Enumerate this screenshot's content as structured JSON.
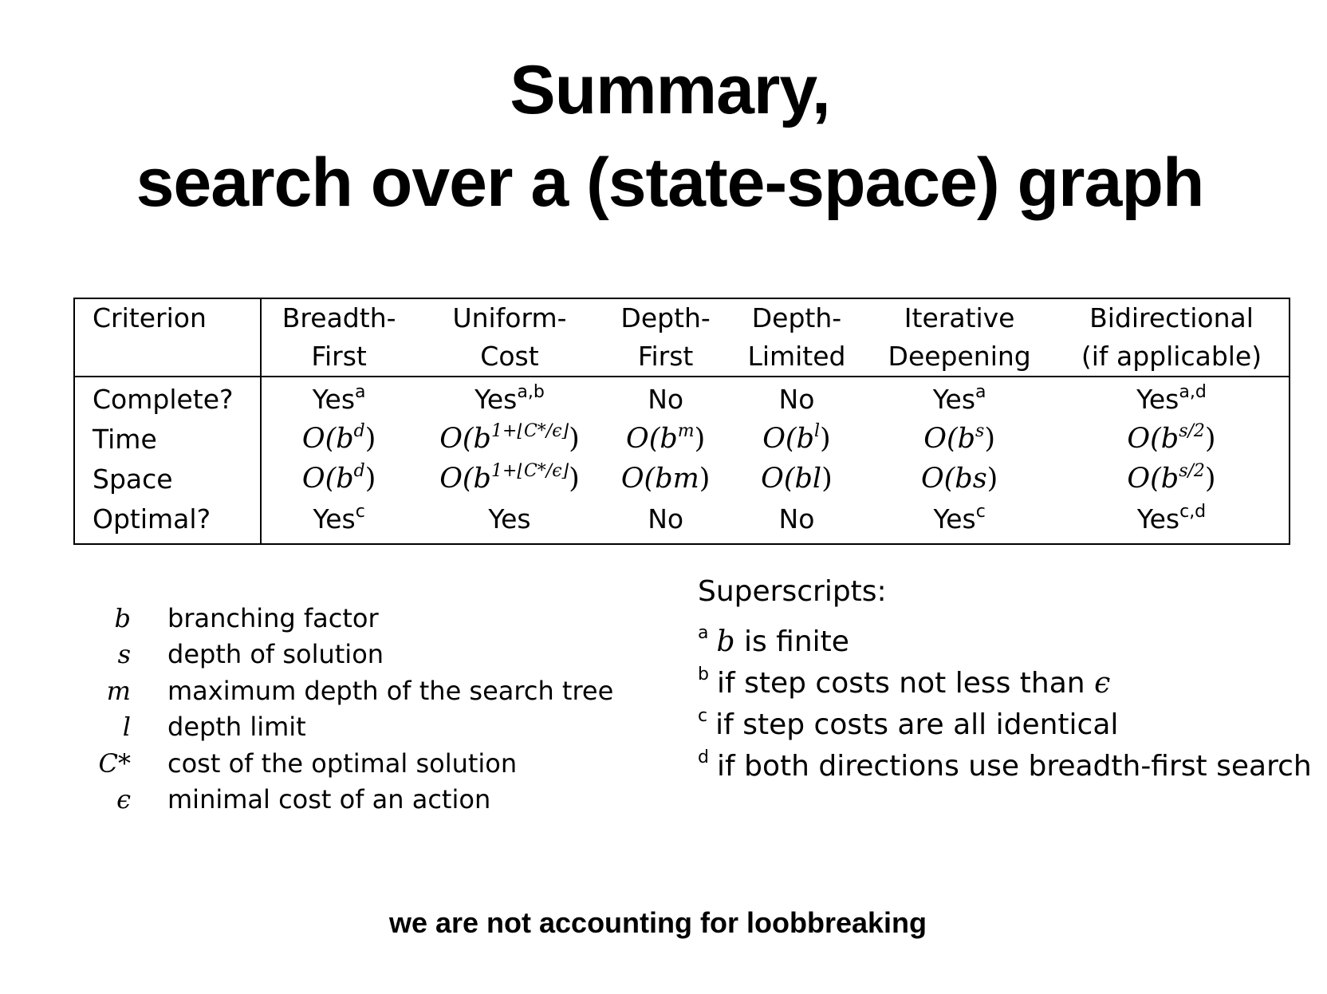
{
  "title": {
    "line1": "Summary,",
    "line2": "search over a (state-space) graph"
  },
  "table": {
    "headers": [
      {
        "line1": "Criterion",
        "line2": ""
      },
      {
        "line1": "Breadth-",
        "line2": "First"
      },
      {
        "line1": "Uniform-",
        "line2": "Cost"
      },
      {
        "line1": "Depth-",
        "line2": "First"
      },
      {
        "line1": "Depth-",
        "line2": "Limited"
      },
      {
        "line1": "Iterative",
        "line2": "Deepening"
      },
      {
        "line1": "Bidirectional",
        "line2": "(if applicable)"
      }
    ],
    "rows": [
      {
        "label": "Complete?",
        "cells": [
          {
            "text": "Yes",
            "sup": "a"
          },
          {
            "text": "Yes",
            "sup": "a,b"
          },
          {
            "text": "No",
            "sup": ""
          },
          {
            "text": "No",
            "sup": ""
          },
          {
            "text": "Yes",
            "sup": "a"
          },
          {
            "text": "Yes",
            "sup": "a,d"
          }
        ]
      },
      {
        "label": "Time",
        "cells": [
          {
            "base": "O(b",
            "exp": "d",
            "close": ")"
          },
          {
            "base": "O(b",
            "exp": "1+⌊C*/ϵ⌋",
            "close": ")"
          },
          {
            "base": "O(b",
            "exp": "m",
            "close": ")"
          },
          {
            "base": "O(b",
            "exp": "l",
            "close": ")"
          },
          {
            "base": "O(b",
            "exp": "s",
            "close": ")"
          },
          {
            "base": "O(b",
            "exp": "s/2",
            "close": ")"
          }
        ]
      },
      {
        "label": "Space",
        "cells": [
          {
            "base": "O(b",
            "exp": "d",
            "close": ")"
          },
          {
            "base": "O(b",
            "exp": "1+⌊C*/ϵ⌋",
            "close": ")"
          },
          {
            "base": "O(bm",
            "exp": "",
            "close": ")"
          },
          {
            "base": "O(bl",
            "exp": "",
            "close": ")"
          },
          {
            "base": "O(bs",
            "exp": "",
            "close": ")"
          },
          {
            "base": "O(b",
            "exp": "s/2",
            "close": ")"
          }
        ]
      },
      {
        "label": "Optimal?",
        "cells": [
          {
            "text": "Yes",
            "sup": "c"
          },
          {
            "text": "Yes",
            "sup": ""
          },
          {
            "text": "No",
            "sup": ""
          },
          {
            "text": "No",
            "sup": ""
          },
          {
            "text": "Yes",
            "sup": "c"
          },
          {
            "text": "Yes",
            "sup": "c,d"
          }
        ]
      }
    ]
  },
  "legend": [
    {
      "symbol": "b",
      "desc": "branching factor"
    },
    {
      "symbol": "s",
      "desc": "depth of solution"
    },
    {
      "symbol": "m",
      "desc": "maximum depth of the search tree"
    },
    {
      "symbol": "l",
      "desc": "depth limit"
    },
    {
      "symbol": "C*",
      "desc": "cost of the optimal solution"
    },
    {
      "symbol": "ϵ",
      "desc": "minimal cost of an action"
    }
  ],
  "superscripts": {
    "heading": "Superscripts:",
    "items": [
      {
        "mark": "a",
        "var": "b",
        "text": " is finite",
        "trail": ""
      },
      {
        "mark": "b",
        "var": "",
        "text": "if step costs not less than ",
        "trail": "ϵ"
      },
      {
        "mark": "c",
        "var": "",
        "text": "if step costs are all identical",
        "trail": ""
      },
      {
        "mark": "d",
        "var": "",
        "text": "if both directions use breadth-first search",
        "trail": ""
      }
    ]
  },
  "footnote": "we are not accounting for loobbreaking"
}
